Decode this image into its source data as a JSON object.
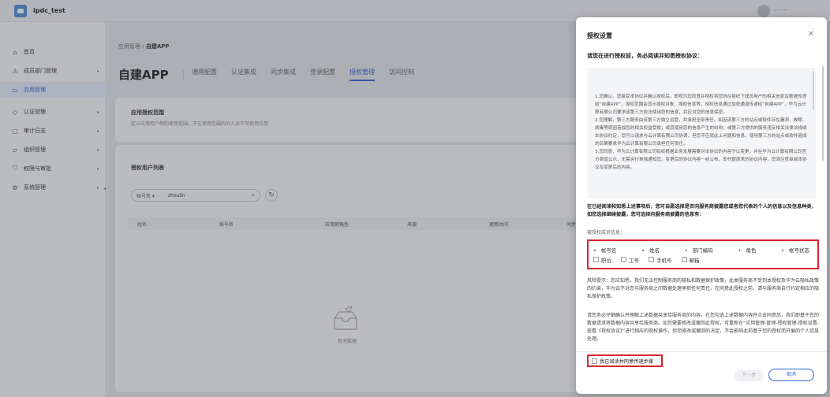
{
  "app": {
    "title": "ipdc_test",
    "user_name": "··· ····"
  },
  "sidebar": {
    "items": [
      {
        "label": "首页",
        "icon": "home-icon"
      },
      {
        "label": "成员部门管理",
        "icon": "user-icon"
      },
      {
        "label": "应用管理",
        "icon": "app-icon"
      },
      {
        "label": "认证管理",
        "icon": "auth-icon"
      },
      {
        "label": "审计日志",
        "icon": "log-icon"
      },
      {
        "label": "组织管理",
        "icon": "folder-icon"
      },
      {
        "label": "权限与审批",
        "icon": "shield-icon"
      },
      {
        "label": "系统管理",
        "icon": "gear-icon"
      }
    ]
  },
  "main": {
    "breadcrumb": {
      "parent": "应用管理",
      "sep": "/",
      "current": "自建APP"
    },
    "page_title": "自建APP",
    "tabs": [
      "通用配置",
      "认证集成",
      "同步集成",
      "登录配置",
      "授权管理",
      "访问控制"
    ],
    "scope": {
      "title": "应用授权范围",
      "desc": "定义应用用户侧的使用范围，不在使用范围内的人员不可使用应用"
    },
    "userlist": {
      "title": "授权用户列表",
      "filter_type": "帐号名",
      "filter_value": "zhoulin",
      "columns": [
        "姓名",
        "帐号名",
        "应用侧角色",
        "来源",
        "更新时间",
        "同步"
      ],
      "empty_text": "暂无数据"
    }
  },
  "dialog": {
    "title": "授权设置",
    "lead": "请您在进行授权前，务必阅读并知悉授权协议：",
    "agreement": [
      "1.您确认，您接受本协议并确认授权后，即视为您同意并授权将您所在组织下成员用户的相关信息及数据传递给“自建APP”，授权范围会显示授权对象、授权信息等，授权信息通过加密通道传递给“自建APP”，华为云计算有限公司要求该第三方依法使用您的信息，并应对您的信息保密。",
      "2.您理解，第三方服务由该第三方独立运营，并承担全部责任。如因该第三方的站点或软件存在漏洞、故障、病毒等原因造成您的相关权益受损；或其使用您的信息产生的纠纷；或第三方提供的服务违反相关法律法规或本协议约定，您可以请求与云计算有限公司协调，但您不应就此上问题和信息、使用第三方的站点或软件造成的后果要求华为云计算有限公司承担任何责任。",
      "3.您同意，华为云计算有限公司有权根据业务发展需要对本协议的内容予以变更，并在华为云计算有限公司官方渠道公示，无需另行单独通知您。变更后的协议内容一经公布，即代替原来的协议内容，您须注意审阅本协议及变更后的内容。"
    ],
    "question": "在已经阅读和知悉上述事项后，您可自愿选择是否向服务商披露您或者您代表的个人的信息以及信息种类，如您选择继续披露，您可选择向服务商披露的信息有：",
    "info_label": "被授权成员信息：",
    "required_fields": [
      "帐号名",
      "姓名",
      "部门编码",
      "角色",
      "帐号状态"
    ],
    "optional_fields": [
      "职位",
      "工号",
      "手机号",
      "邮箱"
    ],
    "risk": "风险提示：您应知悉，我们无法控制服务商的隐私和数据保护政策，此类服务商不受到本授权及华为云隐私政策的约束，华为云不对您与服务商之间数据处理承担任何责任。在同意此授权之前，请与服务商自行约定相应的隐私保护政策。",
    "notice": "请您务必仔细确认并理解上述数据共享给服务商的内容，在您勾选上述数据内容并点击同意后，我们即基于您的数据请求将数据内容共享给服务商。如您需要修改或撤回此授权，可重新在“应用管理-管理-授权管理-授权设置-查看《授权协议》”进行相应的授权操作，但您修改或撤回的决定，不会影响此前基于您的授权而开展的个人信息处理。",
    "consent_label": "我已阅读并同意传递步骤",
    "next_label": "下一步",
    "cancel_label": "取消"
  },
  "colors": {
    "accent": "#2d64d8",
    "highlight": "#d9252d"
  }
}
